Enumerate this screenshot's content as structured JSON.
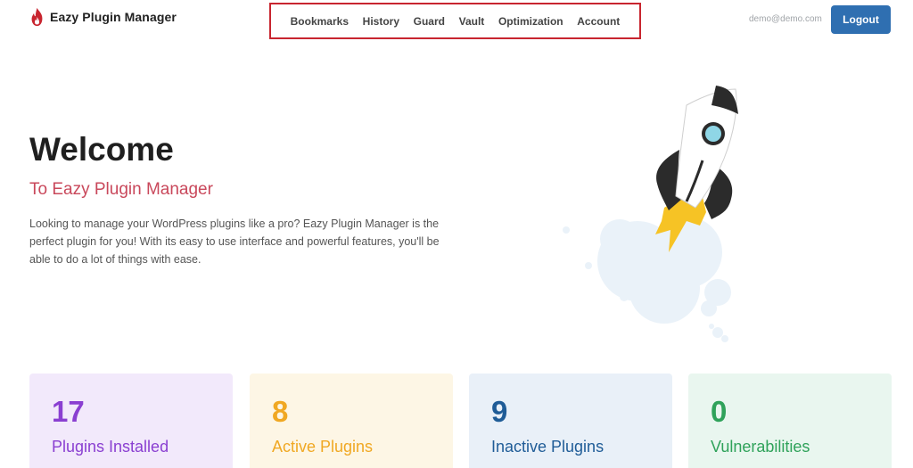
{
  "app": {
    "brand_name": "Eazy Plugin Manager",
    "brand_color": "#c8252f"
  },
  "nav": {
    "items": [
      {
        "label": "Bookmarks"
      },
      {
        "label": "History"
      },
      {
        "label": "Guard"
      },
      {
        "label": "Vault"
      },
      {
        "label": "Optimization"
      },
      {
        "label": "Account"
      }
    ]
  },
  "user": {
    "email": "demo@demo.com",
    "logout_label": "Logout",
    "logout_color": "#2f6fb1"
  },
  "hero": {
    "title": "Welcome",
    "subtitle": "To Eazy Plugin Manager",
    "description": "Looking to manage your WordPress plugins like a pro? Eazy Plugin Manager is the perfect plugin for you! With its easy to use interface and powerful features, you'll be able to do a lot of things with ease.",
    "illustration": "rocket-icon"
  },
  "stats": [
    {
      "value": "17",
      "label": "Plugins Installed",
      "color": "#8a3fd1"
    },
    {
      "value": "8",
      "label": "Active Plugins",
      "color": "#f0a823"
    },
    {
      "value": "9",
      "label": "Inactive Plugins",
      "color": "#1f5c97"
    },
    {
      "value": "0",
      "label": "Vulnerabilities",
      "color": "#2fa25a"
    }
  ]
}
